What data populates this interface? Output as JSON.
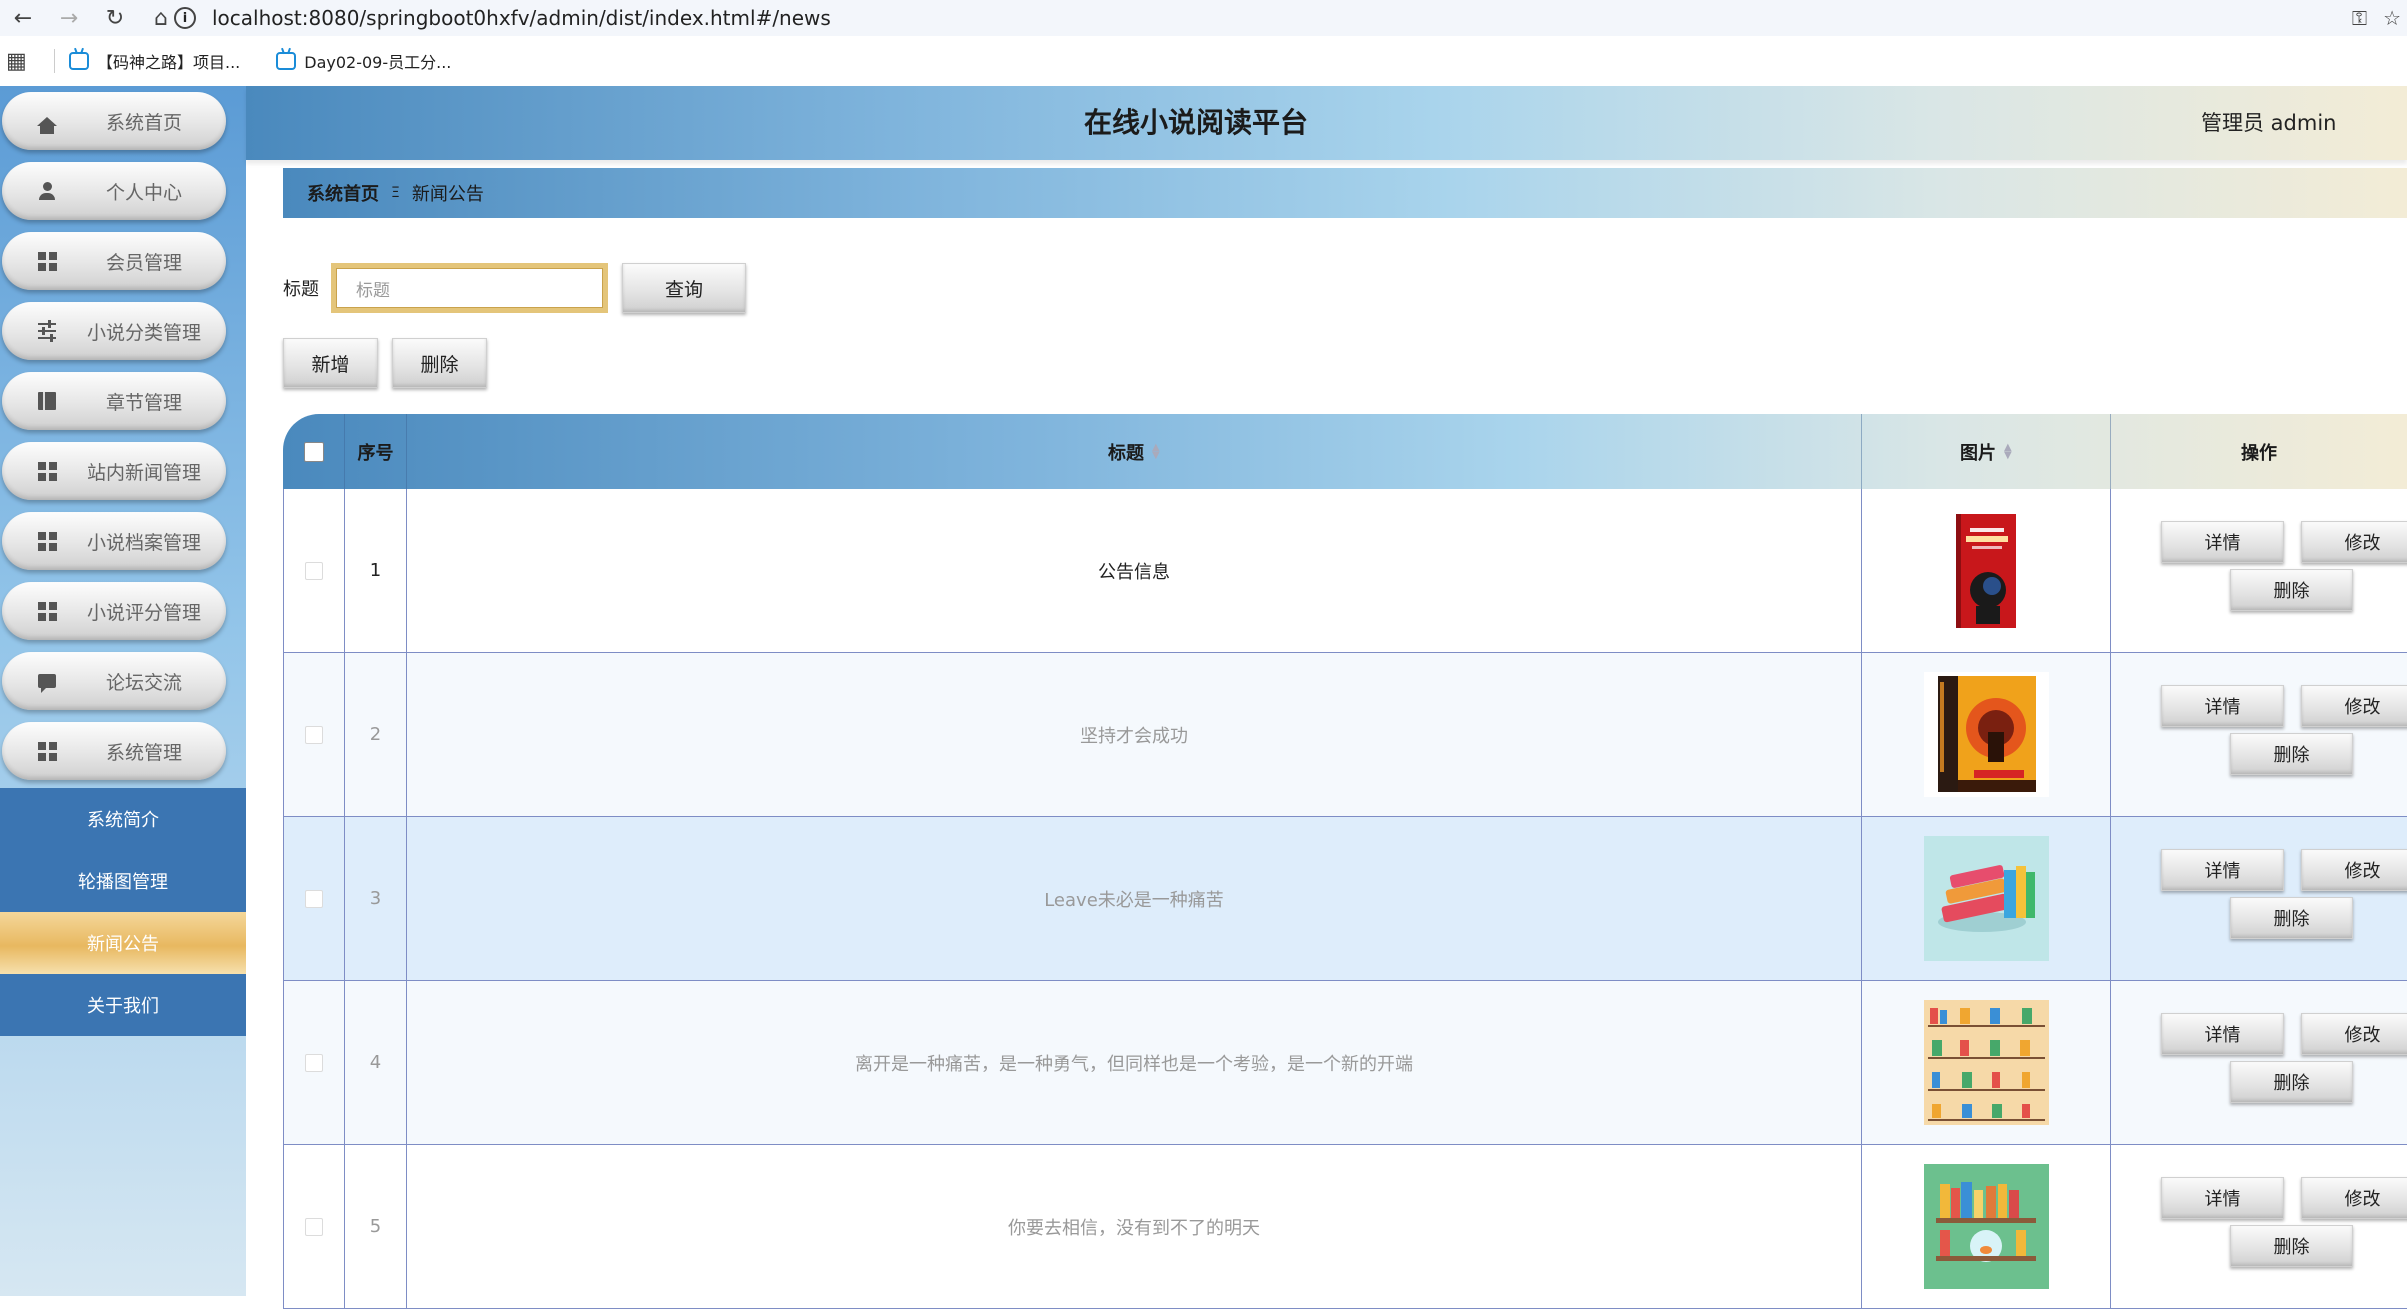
{
  "browser": {
    "url": "localhost:8080/springboot0hxfv/admin/dist/index.html#/news",
    "bookmarks": [
      "【码神之路】项目...",
      "Day02-09-员工分..."
    ]
  },
  "app": {
    "title": "在线小说阅读平台",
    "user_info": "管理员 admin"
  },
  "sidebar": {
    "items": [
      {
        "label": "系统首页",
        "icon": "home-icon"
      },
      {
        "label": "个人中心",
        "icon": "user-icon"
      },
      {
        "label": "会员管理",
        "icon": "grid-icon"
      },
      {
        "label": "小说分类管理",
        "icon": "sliders-icon"
      },
      {
        "label": "章节管理",
        "icon": "book-icon"
      },
      {
        "label": "站内新闻管理",
        "icon": "grid-icon"
      },
      {
        "label": "小说档案管理",
        "icon": "grid-icon"
      },
      {
        "label": "小说评分管理",
        "icon": "grid-icon"
      },
      {
        "label": "论坛交流",
        "icon": "chat-icon"
      },
      {
        "label": "系统管理",
        "icon": "grid-icon"
      }
    ],
    "submenu": [
      {
        "label": "系统简介",
        "active": false
      },
      {
        "label": "轮播图管理",
        "active": false
      },
      {
        "label": "新闻公告",
        "active": true
      },
      {
        "label": "关于我们",
        "active": false
      }
    ]
  },
  "breadcrumb": {
    "home": "系统首页",
    "separator": "Ξ",
    "current": "新闻公告"
  },
  "search": {
    "label": "标题",
    "placeholder": "标题",
    "button": "查询"
  },
  "actions": {
    "add": "新增",
    "delete": "删除"
  },
  "table": {
    "headers": {
      "index": "序号",
      "title": "标题",
      "image": "图片",
      "ops": "操作"
    },
    "row_buttons": {
      "detail": "详情",
      "edit": "修改",
      "delete": "删除"
    },
    "rows": [
      {
        "index": "1",
        "title": "公告信息",
        "image": "red-book-cover"
      },
      {
        "index": "2",
        "title": "坚持才会成功",
        "image": "three-body-book-set"
      },
      {
        "index": "3",
        "title": "Leave未必是一种痛苦",
        "image": "book-stack-illustration"
      },
      {
        "index": "4",
        "title": "离开是一种痛苦，是一种勇气，但同样也是一个考验，是一个新的开端",
        "image": "bookshelf-grid-illustration"
      },
      {
        "index": "5",
        "title": "你要去相信，没有到不了的明天",
        "image": "bookshelf-fishbowl-illustration"
      }
    ]
  },
  "colors": {
    "accent_blue": "#3b75b2",
    "active_gold": "#e8b860",
    "header_gradient_start": "#4a89bd",
    "header_gradient_end": "#f3ecd6"
  }
}
